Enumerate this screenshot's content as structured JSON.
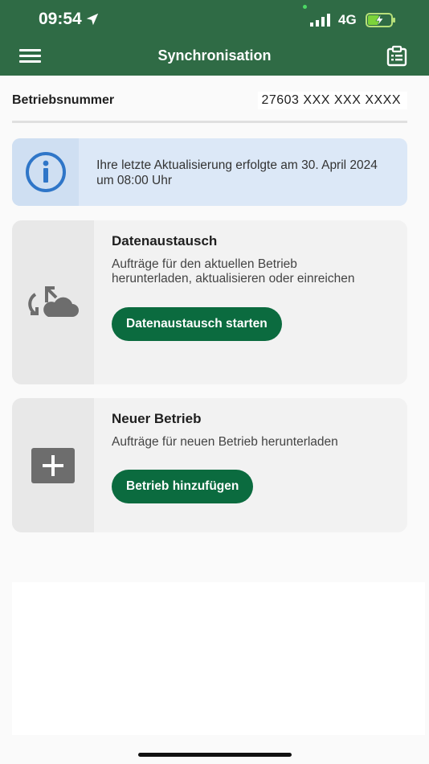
{
  "status_bar": {
    "time": "09:54",
    "network": "4G",
    "icons": [
      "location-arrow-icon",
      "signal-icon",
      "battery-charging-icon"
    ]
  },
  "nav": {
    "title": "Synchronisation",
    "icons": [
      "hamburger-menu-icon",
      "clipboard-icon"
    ]
  },
  "operation": {
    "label": "Betriebsnummer",
    "value": "27603 XXX XXX XXXX"
  },
  "notice": {
    "icon": "info-icon",
    "text": "Ihre letzte Aktualisierung erfolgte am 30. April 2024 um 08:00 Uhr"
  },
  "cards": [
    {
      "icon": "sync-cloud-icon",
      "title": "Datenaustausch",
      "description": "Aufträge für den aktuellen Betrieb herunterladen, aktualisieren oder einreichen",
      "button": "Datenaustausch starten"
    },
    {
      "icon": "plus-box-icon",
      "title": "Neuer Betrieb",
      "description": "Aufträge für neuen Betrieb herunterladen",
      "button": "Betrieb hinzufügen"
    }
  ],
  "colors": {
    "header": "#2f6b45",
    "button": "#0b6b3f",
    "notice": "#dce8f7",
    "info_icon": "#2f76c8"
  }
}
